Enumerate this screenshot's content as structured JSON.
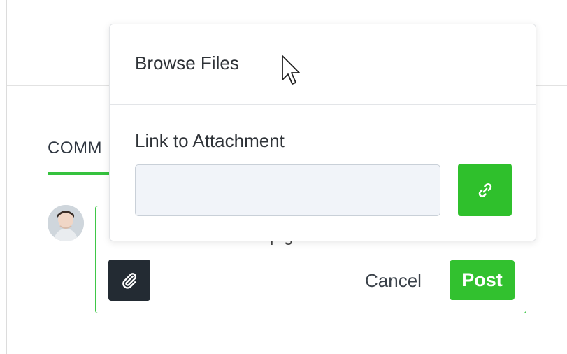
{
  "comments": {
    "tab_label": "COMM"
  },
  "composer": {
    "text_fragment": "p      g",
    "cancel_label": "Cancel",
    "post_label": "Post"
  },
  "attachment_menu": {
    "browse_label": "Browse Files",
    "link_label": "Link to Attachment",
    "link_input_value": "",
    "link_input_placeholder": ""
  },
  "icons": {
    "attach": "paperclip-icon",
    "link_submit": "link-icon",
    "cursor": "mouse-pointer-icon"
  },
  "colors": {
    "accent_green": "#32c12f",
    "dark_button": "#232b33",
    "input_bg": "#f1f4f9"
  }
}
